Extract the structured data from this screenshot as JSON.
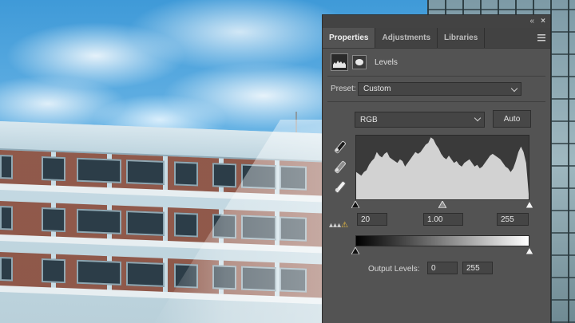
{
  "panel": {
    "collapse_glyph": "«",
    "close_glyph": "×",
    "tabs": [
      {
        "label": "Properties",
        "active": true
      },
      {
        "label": "Adjustments",
        "active": false
      },
      {
        "label": "Libraries",
        "active": false
      }
    ],
    "adjustment_name": "Levels"
  },
  "levels": {
    "preset_label": "Preset:",
    "preset_value": "Custom",
    "channel_value": "RGB",
    "auto_label": "Auto",
    "input_black": "20",
    "input_gamma": "1.00",
    "input_white": "255",
    "input_handles": {
      "black": 0,
      "gray": 0.5,
      "white": 1
    },
    "output_label": "Output Levels:",
    "output_black": "0",
    "output_white": "255",
    "output_handles": {
      "black": 0,
      "white": 1
    }
  },
  "histogram": [
    30,
    28,
    26,
    30,
    32,
    38,
    42,
    45,
    52,
    48,
    46,
    50,
    52,
    46,
    44,
    42,
    40,
    44,
    42,
    36,
    40,
    44,
    48,
    52,
    50,
    52,
    56,
    60,
    62,
    68,
    66,
    60,
    56,
    50,
    46,
    44,
    48,
    44,
    40,
    42,
    38,
    36,
    40,
    42,
    44,
    40,
    36,
    38,
    34,
    36,
    40,
    44,
    48,
    50,
    48,
    46,
    44,
    40,
    36,
    34,
    30,
    34,
    42,
    52,
    58,
    52,
    40,
    6
  ]
}
